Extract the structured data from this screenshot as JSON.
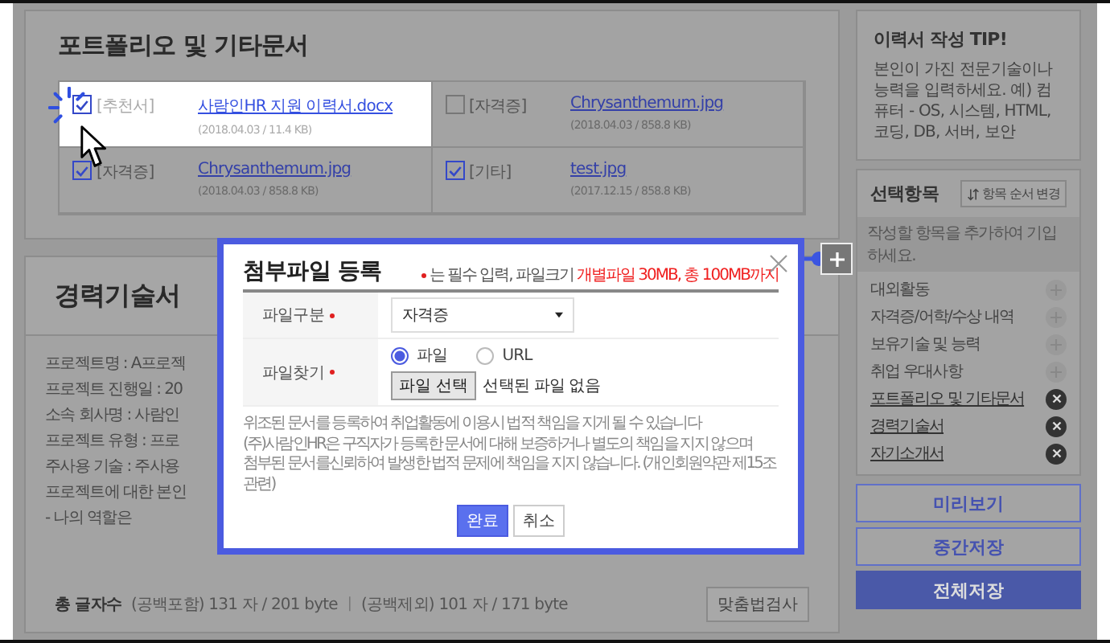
{
  "portfolio": {
    "title": "포트폴리오 및 기타문서",
    "files": [
      {
        "tag": "[추천서]",
        "name": "사람인HR 지원 이력서.docx",
        "meta": "(2018.04.03 / 11.4 KB)",
        "checked": true,
        "highlighted": true
      },
      {
        "tag": "[자격증]",
        "name": "Chrysanthemum.jpg",
        "meta": "(2018.04.03 / 858.8 KB)",
        "checked": false,
        "highlighted": false
      },
      {
        "tag": "[자격증]",
        "name": "Chrysanthemum.jpg",
        "meta": "(2018.04.03 / 858.8 KB)",
        "checked": true,
        "highlighted": false
      },
      {
        "tag": "[기타]",
        "name": "test.jpg",
        "meta": "(2017.12.15 / 858.8 KB)",
        "checked": true,
        "highlighted": false
      }
    ]
  },
  "career": {
    "title": "경력기술서",
    "lines": [
      "프로젝트명 : A프로젝",
      "프로젝트 진행일 : 20",
      "소속 회사명 : 사람인",
      "프로젝트 유형 : 프로",
      "주사용 기술 : 주사용",
      "프로젝트에 대한 본인",
      "- 나의 역할은"
    ],
    "count_label": "총 글자수",
    "count_with_spaces": "(공백포함) 131 자 / 201 byte",
    "count_separator": "|",
    "count_without_spaces": "(공백제외) 101 자 / 171 byte",
    "spell_check_button": "맞춤법검사"
  },
  "tip": {
    "title": "이력서 작성 TIP!",
    "text": "본인이 가진 전문기술이나 능력을 입력하세요. 예) 컴퓨터 - OS, 시스템, HTML, 코딩, DB, 서버, 보안"
  },
  "sections": {
    "title": "선택항목",
    "reorder_button": "항목 순서 변경",
    "hint": "작성할 항목을 추가하여 기입하세요.",
    "items": [
      {
        "label": "대외활동",
        "added": false
      },
      {
        "label": "자격증/어학/수상 내역",
        "added": false
      },
      {
        "label": "보유기술 및 능력",
        "added": false
      },
      {
        "label": "취업 우대사항",
        "added": false
      },
      {
        "label": "포트폴리오 및 기타문서",
        "added": true
      },
      {
        "label": "경력기술서",
        "added": true
      },
      {
        "label": "자기소개서",
        "added": true
      }
    ]
  },
  "actions": [
    {
      "label": "미리보기",
      "kind": "outline"
    },
    {
      "label": "중간저장",
      "kind": "outline"
    },
    {
      "label": "전체저장",
      "kind": "primary"
    }
  ],
  "dialog": {
    "title": "첨부파일 등록",
    "note": "는 필수 입력, 파일크기",
    "note_limit": "개별파일 30MB, 총 100MB까지",
    "fields": [
      {
        "kind": "select",
        "label": "파일구분",
        "required": true,
        "value": "자격증"
      },
      {
        "kind": "file",
        "label": "파일찾기",
        "required": true,
        "options": [
          {
            "label": "파일",
            "selected": true
          },
          {
            "label": "URL",
            "selected": false
          }
        ],
        "button": "파일 선택",
        "status": "선택된 파일 없음"
      }
    ],
    "notice": [
      "위조된 문서를 등록하여 취업활동에 이용시 법적 책임을 지게 될 수 있습니다",
      "(주)사람인HR은 구직자가 등록한 문서에 대해 보증하거나 별도의 책임을 지지 않으며",
      "첨부된 문서를신뢰하여 발생한 법적 문제에 책임을 지지 않습니다. (개인회원약관 제15조 관련)"
    ],
    "buttons": [
      {
        "label": "완료",
        "kind": "primary"
      },
      {
        "label": "취소",
        "kind": "secondary"
      }
    ]
  }
}
